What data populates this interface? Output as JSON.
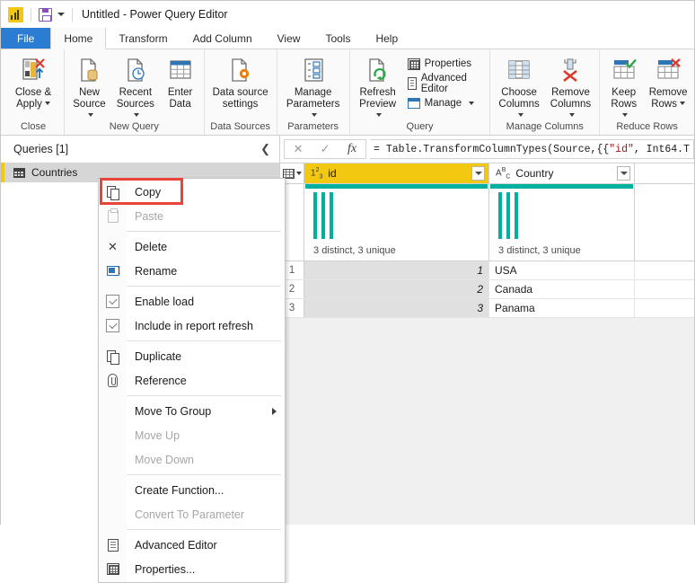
{
  "titlebar": {
    "app_icon": "powerbi-icon",
    "save_icon": "save-icon",
    "customize_caret": "chevron-down-icon",
    "title": "Untitled - Power Query Editor"
  },
  "ribbon": {
    "tabs": [
      {
        "label": "File",
        "state": "file"
      },
      {
        "label": "Home",
        "state": "active"
      },
      {
        "label": "Transform",
        "state": "normal"
      },
      {
        "label": "Add Column",
        "state": "normal"
      },
      {
        "label": "View",
        "state": "normal"
      },
      {
        "label": "Tools",
        "state": "normal"
      },
      {
        "label": "Help",
        "state": "normal"
      }
    ],
    "groups": [
      {
        "label": "Close",
        "buttons": [
          {
            "line1": "Close &",
            "line2": "Apply",
            "icon": "close-apply-icon",
            "caret": true
          }
        ]
      },
      {
        "label": "New Query",
        "buttons": [
          {
            "line1": "New",
            "line2": "Source",
            "icon": "new-source-icon",
            "caret": true
          },
          {
            "line1": "Recent",
            "line2": "Sources",
            "icon": "recent-sources-icon",
            "caret": true
          },
          {
            "line1": "Enter",
            "line2": "Data",
            "icon": "enter-data-icon",
            "caret": false
          }
        ]
      },
      {
        "label": "Data Sources",
        "buttons": [
          {
            "line1": "Data source",
            "line2": "settings",
            "icon": "data-source-settings-icon",
            "caret": false
          }
        ]
      },
      {
        "label": "Parameters",
        "buttons": [
          {
            "line1": "Manage",
            "line2": "Parameters",
            "icon": "manage-parameters-icon",
            "caret": true
          }
        ]
      },
      {
        "label": "Query",
        "buttons": [
          {
            "line1": "Refresh",
            "line2": "Preview",
            "icon": "refresh-preview-icon",
            "caret": true
          }
        ],
        "small_buttons": [
          {
            "label": "Properties",
            "icon": "properties-icon",
            "caret": false
          },
          {
            "label": "Advanced Editor",
            "icon": "advanced-editor-icon",
            "caret": false
          },
          {
            "label": "Manage",
            "icon": "manage-icon",
            "caret": true
          }
        ]
      },
      {
        "label": "Manage Columns",
        "buttons": [
          {
            "line1": "Choose",
            "line2": "Columns",
            "icon": "choose-columns-icon",
            "caret": true
          },
          {
            "line1": "Remove",
            "line2": "Columns",
            "icon": "remove-columns-icon",
            "caret": true
          }
        ]
      },
      {
        "label": "Reduce Rows",
        "buttons": [
          {
            "line1": "Keep",
            "line2": "Rows",
            "icon": "keep-rows-icon",
            "caret": true
          },
          {
            "line1": "Remove",
            "line2": "Rows",
            "icon": "remove-rows-icon",
            "caret": true
          }
        ]
      }
    ]
  },
  "queries_pane": {
    "header": "Queries [1]",
    "collapse_icon": "chevron-left-icon",
    "items": [
      {
        "label": "Countries",
        "icon": "table-icon",
        "selected": true
      }
    ]
  },
  "formula_bar": {
    "cancel_icon": "x-icon",
    "confirm_icon": "check-icon",
    "fx_icon": "fx-icon",
    "formula_prefix": "= Table.TransformColumnTypes(Source,{{",
    "formula_string": "\"id\"",
    "formula_suffix": ", Int64.T"
  },
  "grid": {
    "corner_icon": "select-all-table-icon",
    "columns": [
      {
        "name": "id",
        "type_icon": "number-type-icon",
        "type_glyph": "123",
        "selected": true,
        "quality": "3 distinct, 3 unique",
        "filter_icon": "filter-dropdown-icon"
      },
      {
        "name": "Country",
        "type_icon": "text-type-icon",
        "type_glyph": "ABC",
        "selected": false,
        "quality": "3 distinct, 3 unique",
        "filter_icon": "filter-dropdown-icon"
      }
    ],
    "rows": [
      {
        "num": "1",
        "id": "1",
        "country": "USA"
      },
      {
        "num": "2",
        "id": "2",
        "country": "Canada"
      },
      {
        "num": "3",
        "id": "3",
        "country": "Panama"
      }
    ]
  },
  "context_menu": {
    "items": [
      {
        "label": "Copy",
        "icon": "copy-icon",
        "enabled": true,
        "submenu": false,
        "highlighted": true
      },
      {
        "label": "Paste",
        "icon": "paste-icon",
        "enabled": false,
        "submenu": false
      },
      {
        "separator_after": true
      },
      {
        "label": "Delete",
        "icon": "delete-x-icon",
        "enabled": true,
        "submenu": false
      },
      {
        "label": "Rename",
        "icon": "rename-icon",
        "enabled": true,
        "submenu": false
      },
      {
        "separator_after": true
      },
      {
        "label": "Enable load",
        "icon": "checkbox-checked-icon",
        "enabled": true,
        "submenu": false
      },
      {
        "label": "Include in report refresh",
        "icon": "checkbox-checked-icon",
        "enabled": true,
        "submenu": false
      },
      {
        "separator_after": true
      },
      {
        "label": "Duplicate",
        "icon": "duplicate-icon",
        "enabled": true,
        "submenu": false
      },
      {
        "label": "Reference",
        "icon": "reference-paperclip-icon",
        "enabled": true,
        "submenu": false
      },
      {
        "separator_after": true
      },
      {
        "label": "Move To Group",
        "icon": "none",
        "enabled": true,
        "submenu": true
      },
      {
        "label": "Move Up",
        "icon": "none",
        "enabled": false,
        "submenu": false
      },
      {
        "label": "Move Down",
        "icon": "none",
        "enabled": false,
        "submenu": false
      },
      {
        "separator_after": true
      },
      {
        "label": "Create Function...",
        "icon": "none",
        "enabled": true,
        "submenu": false
      },
      {
        "label": "Convert To Parameter",
        "icon": "none",
        "enabled": false,
        "submenu": false
      },
      {
        "separator_after": true
      },
      {
        "label": "Advanced Editor",
        "icon": "advanced-editor-icon",
        "enabled": true,
        "submenu": false
      },
      {
        "label": "Properties...",
        "icon": "properties-icon",
        "enabled": true,
        "submenu": false
      }
    ]
  },
  "annotation": {
    "highlight_color": "#e8443a",
    "target": "Copy"
  },
  "colors": {
    "accent_blue": "#2b7cd3",
    "brand_yellow": "#f2c811",
    "quality_teal": "#00b0a0",
    "selection_gray": "#d6d6d6"
  }
}
